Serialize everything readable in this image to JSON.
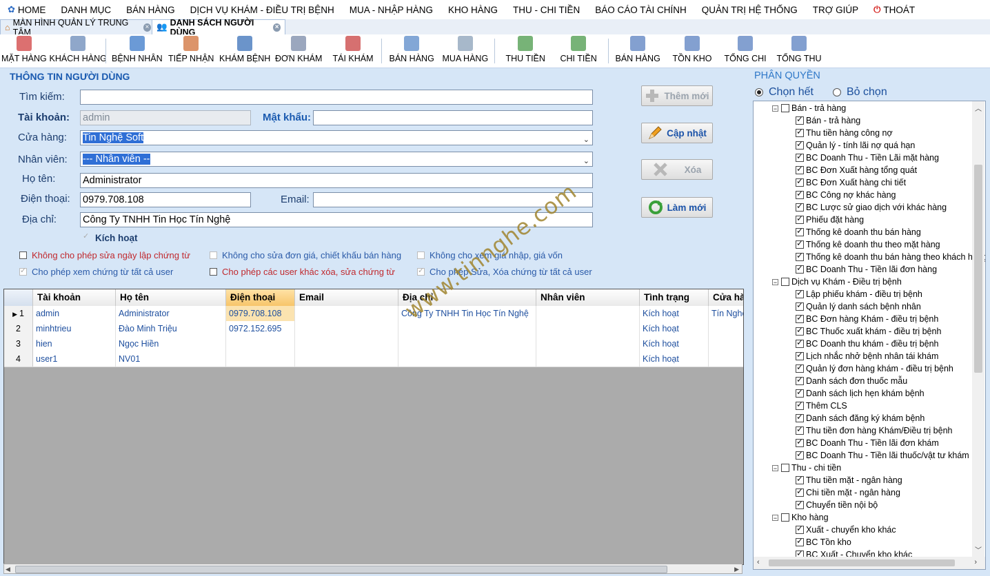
{
  "menu": [
    "HOME",
    "DANH MỤC",
    "BÁN HÀNG",
    "DỊCH VỤ KHÁM - ĐIỀU TRỊ BỆNH",
    "MUA - NHẬP HÀNG",
    "KHO HÀNG",
    "THU - CHI TIỀN",
    "BÁO CÁO TÀI CHÍNH",
    "QUẢN TRỊ HỆ THỐNG",
    "TRỢ GIÚP",
    "THOÁT"
  ],
  "tabs": [
    "MÀN HÌNH QUẢN LÝ TRUNG TÂM",
    "DANH SÁCH NGƯỜI DÙNG"
  ],
  "toolbar": [
    "MẶT HÀNG",
    "KHÁCH HÀNG",
    "BỆNH NHÂN",
    "TIẾP NHẬN",
    "KHÁM BỆNH",
    "ĐƠN KHÁM",
    "TÁI KHÁM",
    "BÁN HÀNG",
    "MUA HÀNG",
    "THU TIỀN",
    "CHI TIỀN",
    "BÁN HÀNG",
    "TỒN KHO",
    "TỔNG CHI",
    "TỔNG THU"
  ],
  "form": {
    "title": "THÔNG TIN NGƯỜI DÙNG",
    "search_label": "Tìm kiếm:",
    "search_value": "",
    "account_label": "Tài khoản:",
    "account_value": "admin",
    "password_label": "Mật khẩu:",
    "password_value": "",
    "store_label": "Cửa hàng:",
    "store_value": "Tin Nghệ Soft",
    "staff_label": "Nhân viên:",
    "staff_value": "--- Nhân viên --",
    "name_label": "Họ tên:",
    "name_value": "Administrator",
    "phone_label": "Điện thoại:",
    "phone_value": "0979.708.108",
    "email_label": "Email:",
    "email_value": "",
    "address_label": "Địa chỉ:",
    "address_value": "Công Ty TNHH Tin Học Tín Nghệ",
    "active_label": "Kích hoạt"
  },
  "options": [
    {
      "label": "Không cho phép sửa ngày lập chứng từ",
      "checked": false,
      "color": "#c0282d"
    },
    {
      "label": "Không cho sửa đơn giá, chiết khấu bán hàng",
      "checked": false,
      "color": "#2a5aa8"
    },
    {
      "label": "Không cho xem giá nhập, giá vốn",
      "checked": false,
      "color": "#2a5aa8"
    },
    {
      "label": "Cho phép xem chứng từ tất cả user",
      "checked": true,
      "color": "#2a5aa8"
    },
    {
      "label": "Cho phép các user khác xóa, sửa chứng từ",
      "checked": false,
      "color": "#c0282d"
    },
    {
      "label": "Cho phép Sửa, Xóa chứng từ tất cả user",
      "checked": true,
      "color": "#2a5aa8"
    }
  ],
  "buttons": {
    "add": "Thêm mới",
    "update": "Cập nhật",
    "delete": "Xóa",
    "refresh": "Làm mới"
  },
  "grid": {
    "columns": [
      "Tài khoản",
      "Họ tên",
      "Điện thoại",
      "Email",
      "Địa chỉ",
      "Nhân viên",
      "Tình trạng",
      "Cửa hàng"
    ],
    "rows": [
      {
        "num": "1",
        "cells": [
          "admin",
          "Administrator",
          "0979.708.108",
          "",
          "Công Ty TNHH Tin Học Tín Nghệ",
          "",
          "Kích hoạt",
          "Tín Nghệ"
        ]
      },
      {
        "num": "2",
        "cells": [
          "minhtrieu",
          "Đào Minh Triệu",
          "0972.152.695",
          "",
          "",
          "",
          "Kích hoạt",
          ""
        ]
      },
      {
        "num": "3",
        "cells": [
          "hien",
          "Ngọc Hiền",
          "",
          "",
          "",
          "",
          "Kích hoạt",
          ""
        ]
      },
      {
        "num": "4",
        "cells": [
          "user1",
          "NV01",
          "",
          "",
          "",
          "",
          "Kích hoạt",
          ""
        ]
      }
    ]
  },
  "permissions": {
    "title": "PHÂN QUYỀN",
    "select_all": "Chọn hết",
    "deselect": "Bỏ chọn",
    "groups": [
      {
        "label": "Bán -  trả hàng",
        "items": [
          "Bán - trả hàng",
          "Thu tiền hàng công nợ",
          "Quản lý - tính lãi nợ quá hạn",
          "BC Doanh Thu - Tiền Lãi mặt hàng",
          "BC Đơn Xuất hàng tổng quát",
          "BC Đơn Xuất hàng chi tiết",
          "BC Công nợ khác hàng",
          "BC Lược sử giao dịch với khác hàng",
          "Phiếu đặt hàng",
          "Thống kê doanh thu bán hàng",
          "Thống kê doanh thu theo mặt hàng",
          "Thống kê doanh thu bán hàng theo khách hàng",
          "BC Doanh Thu - Tiền lãi đơn hàng"
        ]
      },
      {
        "label": "Dịch vụ Khám - Điều trị bệnh",
        "items": [
          "Lập phiếu khám - điều trị bệnh",
          "Quản lý danh sách bệnh nhân",
          "BC Đơn hàng Khám - điều trị bệnh",
          "BC Thuốc xuất khám - điều trị bệnh",
          "BC Doanh thu khám - điều trị bệnh",
          "Lịch nhắc nhở bệnh nhân tái khám",
          "Quản lý đơn hàng khám - điều trị bệnh",
          "Danh sách đơn thuốc mẫu",
          "Danh sách lịch hẹn khám bệnh",
          "Thêm CLS",
          "Danh sách đăng ký khám bệnh",
          "Thu tiền đơn hàng Khám/Điều trị bệnh",
          "BC Doanh Thu - Tiền lãi đơn khám",
          "BC Doanh Thu - Tiền lãi thuốc/vật tư khám"
        ]
      },
      {
        "label": "Thu - chi tiền",
        "items": [
          "Thu tiền mặt - ngân hàng",
          "Chi tiền mặt - ngân hàng",
          "Chuyển tiền nội bộ"
        ]
      },
      {
        "label": "Kho hàng",
        "items": [
          "Xuất - chuyển kho khác",
          "BC Tồn kho",
          "BC Xuất - Chuyển kho khác"
        ]
      }
    ]
  },
  "watermark": "www.tinnghe.com",
  "colors": {
    "accent": "#1a5ab0",
    "background": "#d6e6f7",
    "selected_header": "#f7c56a"
  }
}
